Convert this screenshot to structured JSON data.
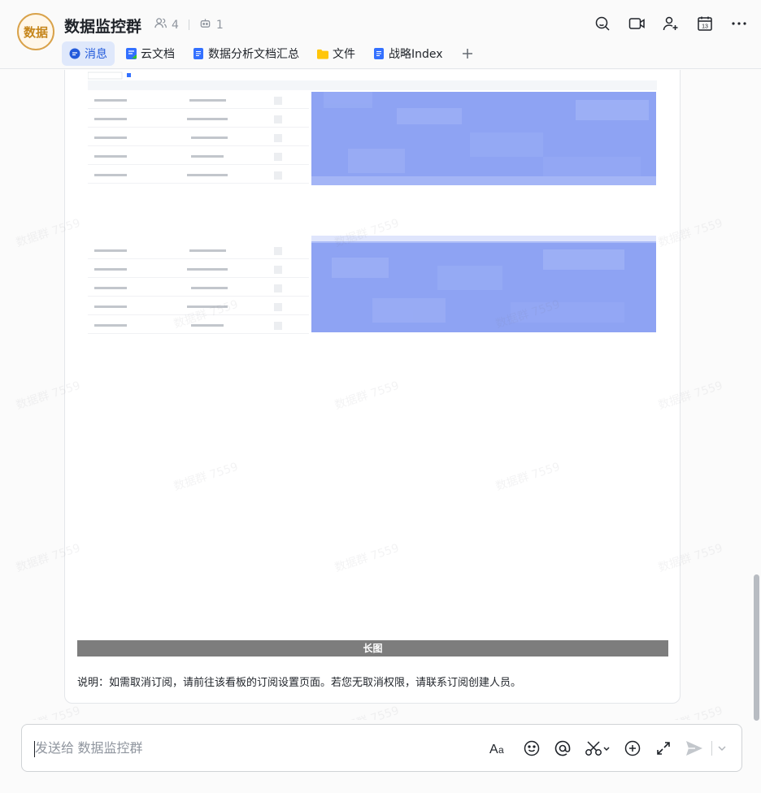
{
  "header": {
    "avatar_text": "数据",
    "title": "数据监控群",
    "member_count": "4",
    "bot_count": "1"
  },
  "tabs": [
    {
      "label": "消息",
      "icon": "message-icon",
      "active": true
    },
    {
      "label": "云文档",
      "icon": "cloud-doc-icon"
    },
    {
      "label": "数据分析文档汇总",
      "icon": "doc-icon"
    },
    {
      "label": "文件",
      "icon": "folder-icon"
    },
    {
      "label": "战略Index",
      "icon": "doc-icon"
    }
  ],
  "message": {
    "long_image_label": "长图",
    "note": "说明：如需取消订阅，请前往该看板的订阅设置页面。若您无取消权限，请联系订阅创建人员。"
  },
  "input": {
    "placeholder": "发送给 数据监控群"
  },
  "watermark_text": "数据群 7559",
  "colors": {
    "accent": "#245bdb",
    "avatar_ring": "#d9a24a",
    "mosaic": "#8fa4f4"
  }
}
